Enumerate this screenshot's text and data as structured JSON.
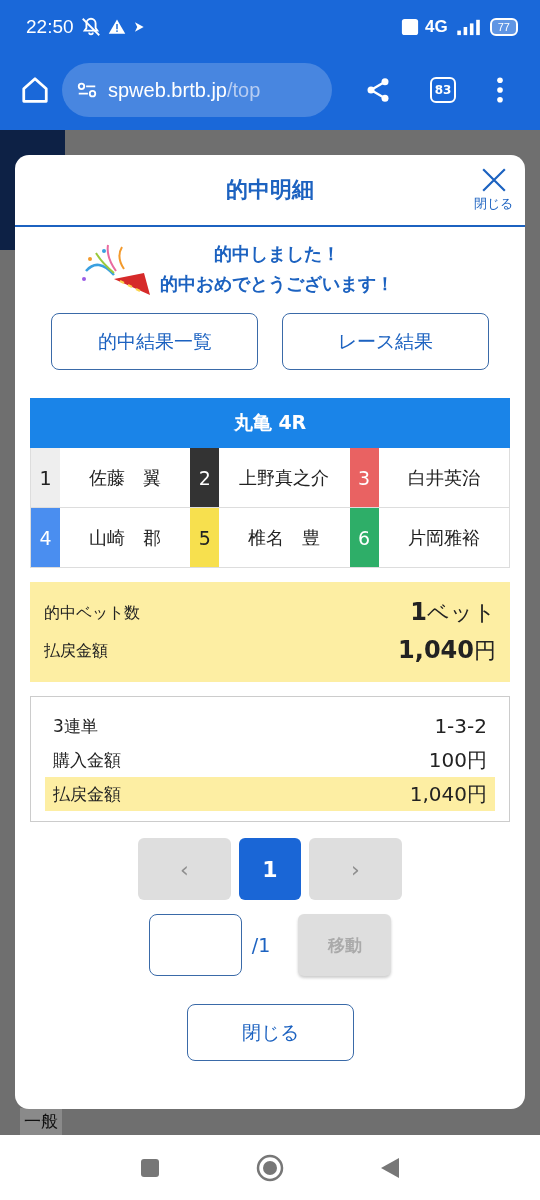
{
  "status_bar": {
    "time": "22:50",
    "network": "4G",
    "battery": "77"
  },
  "browser": {
    "url_host": "spweb.brtb.jp",
    "url_path": "/top",
    "tab_count": "83"
  },
  "background": {
    "label": "一般"
  },
  "dialog": {
    "title": "的中明細",
    "close_label": "閉じる",
    "message": [
      "的中しました！",
      "的中おめでとうございます！"
    ],
    "links": [
      "的中結果一覧",
      "レース結果"
    ],
    "race": {
      "title": "丸亀 4R",
      "racers": [
        {
          "lane": "1",
          "name": "佐藤　翼",
          "color": "#eeeeee"
        },
        {
          "lane": "2",
          "name": "上野真之介",
          "color": "#333333"
        },
        {
          "lane": "3",
          "name": "白井英治",
          "color": "#e96262"
        },
        {
          "lane": "4",
          "name": "山崎　郡",
          "color": "#4a8ef0"
        },
        {
          "lane": "5",
          "name": "椎名　豊",
          "color": "#f7e04e"
        },
        {
          "lane": "6",
          "name": "片岡雅裕",
          "color": "#2eae68"
        }
      ]
    },
    "summary": [
      {
        "label": "的中ベット数",
        "value_number": "1",
        "value_unit": "ベット"
      },
      {
        "label": "払戻金額",
        "value_number": "1,040",
        "value_unit": "円"
      }
    ],
    "details": [
      {
        "label": "3連単",
        "value": "1-3-2",
        "highlight": false
      },
      {
        "label": "購入金額",
        "value": "100円",
        "highlight": false
      },
      {
        "label": "払戻金額",
        "value": "1,040円",
        "highlight": true
      }
    ],
    "pagination": {
      "prev": {
        "label": "‹",
        "disabled": true
      },
      "pages": [
        {
          "label": "1",
          "selected": true
        }
      ],
      "next": {
        "label": "›",
        "disabled": true
      }
    },
    "jump": {
      "total": "/1",
      "button": "移動",
      "button_disabled": true
    },
    "close_button": "閉じる"
  }
}
